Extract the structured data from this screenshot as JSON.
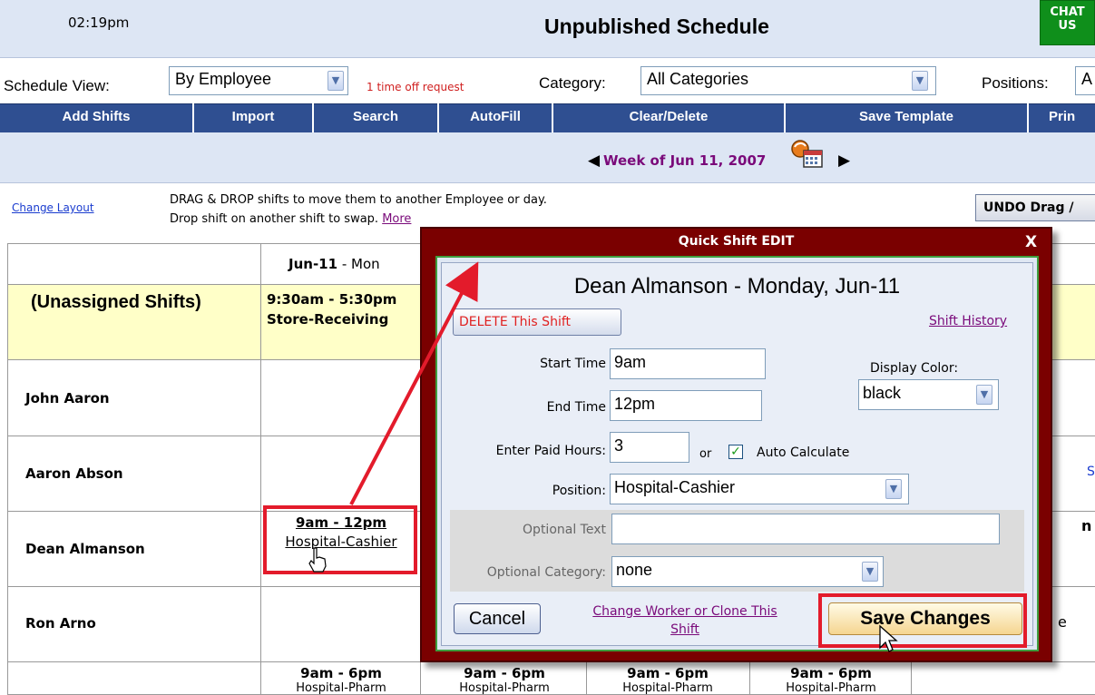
{
  "header": {
    "time": "02:19pm",
    "title": "Unpublished Schedule",
    "chat_label_1": "CHAT",
    "chat_label_2": "US"
  },
  "filters": {
    "view_label": "Schedule View:",
    "view_value": "By Employee",
    "time_off": "1 time off request",
    "category_label": "Category:",
    "category_value": "All Categories",
    "positions_label": "Positions:",
    "positions_value": "A"
  },
  "menu": [
    "Add Shifts",
    "Import",
    "Search",
    "AutoFill",
    "Clear/Delete",
    "Save Template",
    "Prin"
  ],
  "week": {
    "label": "Week of Jun 11, 2007"
  },
  "hint": {
    "change_layout": "Change Layout",
    "line1": "DRAG & DROP shifts to move them to another Employee or day.",
    "line2": "Drop shift on another shift to swap.",
    "more": "More",
    "undo": "UNDO Drag /"
  },
  "grid": {
    "header_day": "Jun-11",
    "header_dow": " - Mon",
    "unassigned_label": "(Unassigned Shifts)",
    "unassigned_time": "9:30am - 5:30pm",
    "unassigned_pos": "Store-Receiving",
    "employees": [
      "John Aaron",
      "Aaron Abson",
      "Dean Almanson",
      "Ron Arno"
    ],
    "dean_time": "9am - 12pm",
    "dean_pos": "Hospital-Cashier",
    "bottom_time": "9am - 6pm",
    "bottom_pos": "Hospital-Pharm",
    "partial_s": "S",
    "partial_n": "n",
    "partial_e": "e"
  },
  "modal": {
    "title": "Quick Shift EDIT",
    "close": "X",
    "heading": "Dean Almanson - Monday, Jun-11",
    "delete": "DELETE This Shift",
    "history": "Shift History",
    "start_label": "Start Time",
    "start_value": "9am",
    "end_label": "End Time",
    "end_value": "12pm",
    "color_label": "Display Color:",
    "color_value": "black",
    "paid_label": "Enter Paid Hours:",
    "paid_value": "3",
    "or_label": "or",
    "auto_calc": "Auto Calculate",
    "position_label": "Position:",
    "position_value": "Hospital-Cashier",
    "opt_text_label": "Optional Text",
    "opt_text_value": "",
    "opt_cat_label": "Optional Category:",
    "opt_cat_value": "none",
    "cancel": "Cancel",
    "change_worker_1": "Change Worker or Clone This",
    "change_worker_2": "Shift",
    "save": "Save Changes"
  },
  "icons": {
    "prev": "◀",
    "next": "▶",
    "dropdown": "▼",
    "check": "✓",
    "cursor": "hand-cursor-icon"
  },
  "colors": {
    "menu": "#2f4f91",
    "modal": "#7a0000",
    "highlight": "#e31b2b",
    "unassigned_row": "#ffffc8"
  }
}
